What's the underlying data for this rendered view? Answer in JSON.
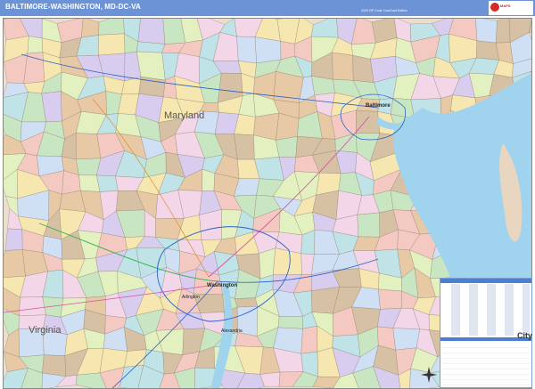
{
  "header": {
    "title": "BALTIMORE-WASHINGTON, MD-DC-VA",
    "edition": "2020 ZIP Code ColorCast Edition",
    "logo": "Market Maps"
  },
  "map": {
    "labels": {
      "state_maryland": "Maryland",
      "state_virginia": "Virginia",
      "city_baltimore": "Baltimore",
      "city_washington": "Washington",
      "city_arlington": "Arlington",
      "city_alexandria": "Alexandria"
    },
    "colors": {
      "header": "#6b93d6",
      "water": "#9fd3ee",
      "zip_fills": [
        "#f4c9c2",
        "#c9e6c3",
        "#d8cdee",
        "#f6e7b0",
        "#bfe3e6",
        "#e7c9a6",
        "#d6c1a4",
        "#f3d6e8",
        "#cfe0f5",
        "#e3f0c0"
      ]
    }
  },
  "legend": {
    "city_sample": "City"
  }
}
